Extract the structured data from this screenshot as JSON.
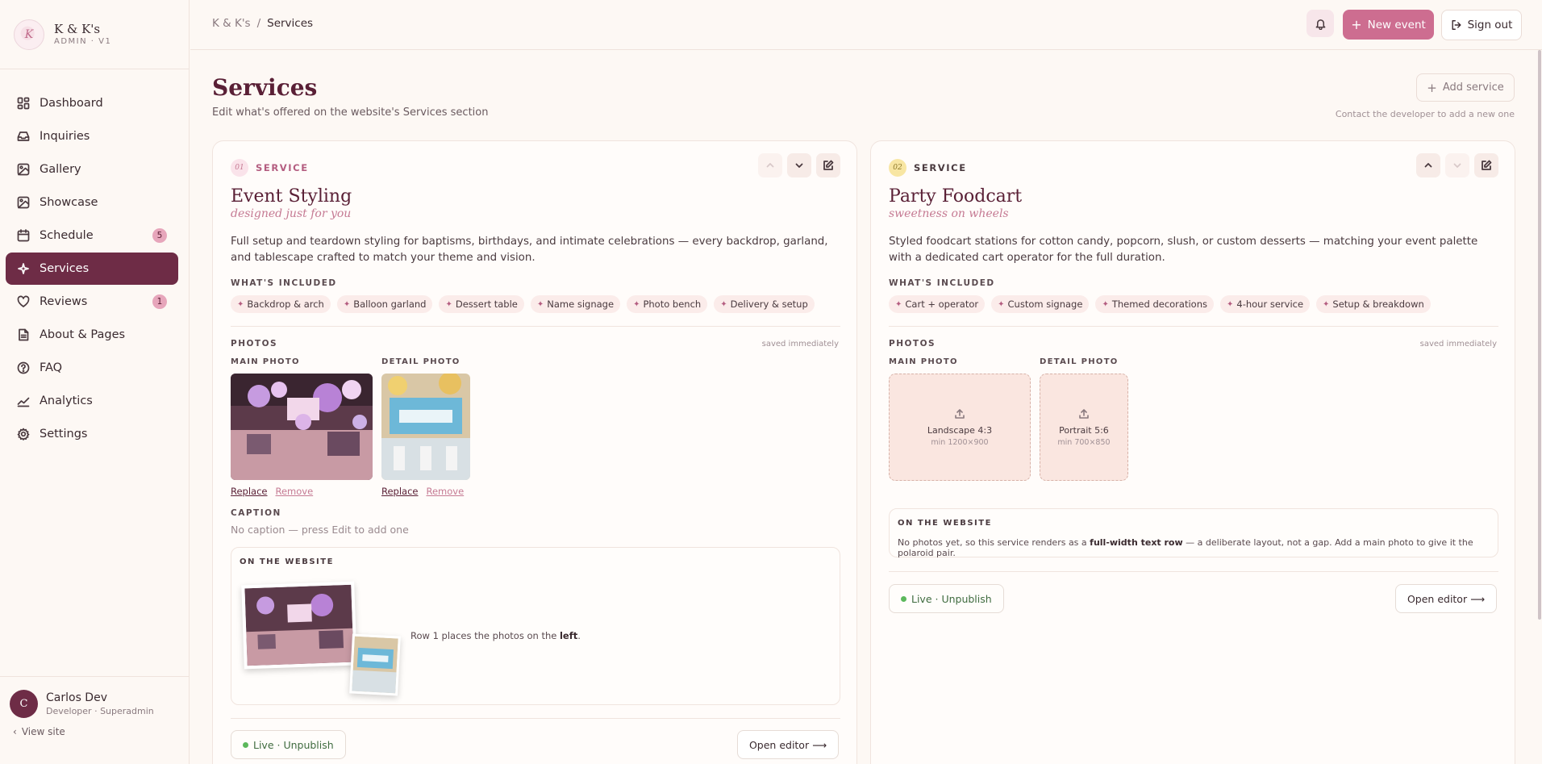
{
  "brand": {
    "name": "K & K's",
    "sub": "ADMIN · V1",
    "logo_glyph": "K"
  },
  "nav": [
    {
      "label": "Dashboard",
      "icon": "grid-icon"
    },
    {
      "label": "Inquiries",
      "icon": "inbox-icon"
    },
    {
      "label": "Gallery",
      "icon": "image-icon"
    },
    {
      "label": "Showcase",
      "icon": "image-icon"
    },
    {
      "label": "Schedule",
      "icon": "calendar-icon",
      "badge": "5"
    },
    {
      "label": "Services",
      "icon": "sparkle-icon",
      "active": true
    },
    {
      "label": "Reviews",
      "icon": "heart-icon",
      "badge": "1"
    },
    {
      "label": "About & Pages",
      "icon": "file-icon"
    },
    {
      "label": "FAQ",
      "icon": "help-icon"
    },
    {
      "label": "Analytics",
      "icon": "chart-icon"
    },
    {
      "label": "Settings",
      "icon": "gear-icon"
    }
  ],
  "user": {
    "initial": "C",
    "name": "Carlos Dev",
    "role": "Developer · Superadmin",
    "view_site": "View site"
  },
  "topbar": {
    "crumb_root": "K & K's",
    "crumb_sep": "/",
    "crumb_current": "Services",
    "new_event": "New event",
    "sign_out": "Sign out"
  },
  "page": {
    "title": "Services",
    "subtitle": "Edit what's offered on the website's Services section",
    "add_service": "Add service",
    "add_note": "Contact the developer to add a new one"
  },
  "labels": {
    "service": "SERVICE",
    "whats_included": "WHAT'S INCLUDED",
    "photos": "PHOTOS",
    "saved": "saved immediately",
    "main_photo": "MAIN PHOTO",
    "detail_photo": "DETAIL PHOTO",
    "caption": "CAPTION",
    "on_website": "ON THE WEBSITE",
    "replace": "Replace",
    "remove": "Remove",
    "live": "Live · Unpublish",
    "open_editor": "Open editor ⟶"
  },
  "services": [
    {
      "num": "01",
      "title": "Event Styling",
      "tagline": "designed just for you",
      "description": "Full setup and teardown styling for baptisms, birthdays, and intimate celebrations — every backdrop, garland, and tablescape crafted to match your theme and vision.",
      "included": [
        "Backdrop & arch",
        "Balloon garland",
        "Dessert table",
        "Name signage",
        "Photo bench",
        "Delivery & setup"
      ],
      "caption": "No caption — press Edit to add one",
      "web_pre": "Row 1 places the photos on the ",
      "web_bold": "left",
      "web_post": "."
    },
    {
      "num": "02",
      "title": "Party Foodcart",
      "tagline": "sweetness on wheels",
      "description": "Styled foodcart stations for cotton candy, popcorn, slush, or custom desserts — matching your event palette with a dedicated cart operator for the full duration.",
      "included": [
        "Cart + operator",
        "Custom signage",
        "Themed decorations",
        "4-hour service",
        "Setup & breakdown"
      ],
      "upload_main_title": "Landscape 4:3",
      "upload_main_sub": "min 1200×900",
      "upload_detail_title": "Portrait 5:6",
      "upload_detail_sub": "min 700×850",
      "web_pre": "No photos yet, so this service renders as a ",
      "web_bold": "full-width text row",
      "web_post": " — a deliberate layout, not a gap. Add a main photo to give it the polaroid pair."
    }
  ]
}
